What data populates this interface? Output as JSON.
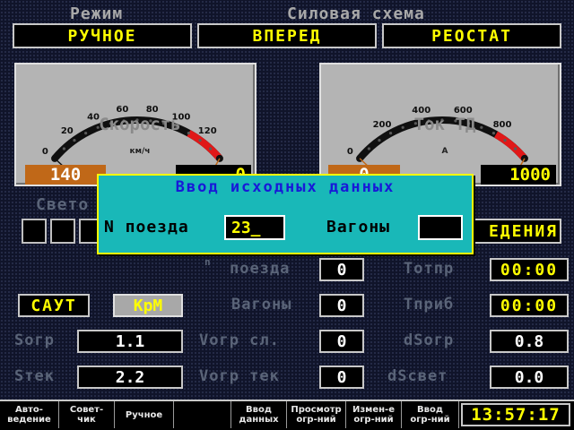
{
  "header": {
    "mode_label": "Режим",
    "mode_value": "РУЧНОЕ",
    "power_label": "Силовая схема",
    "power_value1": "ВПЕРЕД",
    "power_value2": "РЕОСТАТ"
  },
  "speed_gauge": {
    "title": "Скорость",
    "unit": "км/ч",
    "ticks": [
      "0",
      "20",
      "40",
      "60",
      "80",
      "100",
      "120"
    ],
    "left_value": "140",
    "right_value": "0",
    "max": 140,
    "needle_value": 0
  },
  "current_gauge": {
    "title": "Ток ТД",
    "unit": "А",
    "ticks": [
      "0",
      "200",
      "400",
      "600",
      "800"
    ],
    "left_value": "0",
    "right_value": "1000",
    "max": 1000,
    "needle_value": 0
  },
  "signals": {
    "label": "Свето",
    "right_label": "ЕДЕНИЯ"
  },
  "dialog": {
    "title": "Ввод исходных данных",
    "train_label": "N поезда",
    "train_value": "23_",
    "cars_label": "Вагоны",
    "cars_value": ""
  },
  "info": {
    "n_label": "n",
    "poezda_label": "поезда",
    "poezda_value": "0",
    "vagony_label": "Вагоны",
    "vagony_value": "0",
    "vogr_sl_label": "Vогр сл.",
    "vogr_sl_value": "0",
    "vogr_tek_label": "Vогр тек",
    "vogr_tek_value": "0",
    "totpr_label": "Тотпр",
    "totpr_value": "00:00",
    "tprib_label": "Тприб",
    "tprib_value": "00:00",
    "dsogr_label": "dSогр",
    "dsogr_value": "0.8",
    "dsvet_label": "dSсвет",
    "dsvet_value": "0.0"
  },
  "left_panel": {
    "saut_label": "САУТ",
    "krm_label": "КрМ",
    "sogr_label": "Sогр",
    "sogr_value": "1.1",
    "stek_label": "Sтек",
    "stek_value": "2.2"
  },
  "fkeys": [
    "Авто-\nведение",
    "Совет-\nчик",
    "Ручное",
    "",
    "Ввод\nданных",
    "Просмотр\nогр-ний",
    "Измен-е\nогр-ний",
    "Ввод\nогр-ний"
  ],
  "clock": "13:57:17",
  "colors": {
    "accent_yellow": "#ffff00",
    "dialog_bg": "#19b8b8",
    "dialog_title": "#1818d8",
    "gauge_face": "#b4b4b4",
    "orange_box": "#c06818",
    "red_zone": "#e01818"
  }
}
